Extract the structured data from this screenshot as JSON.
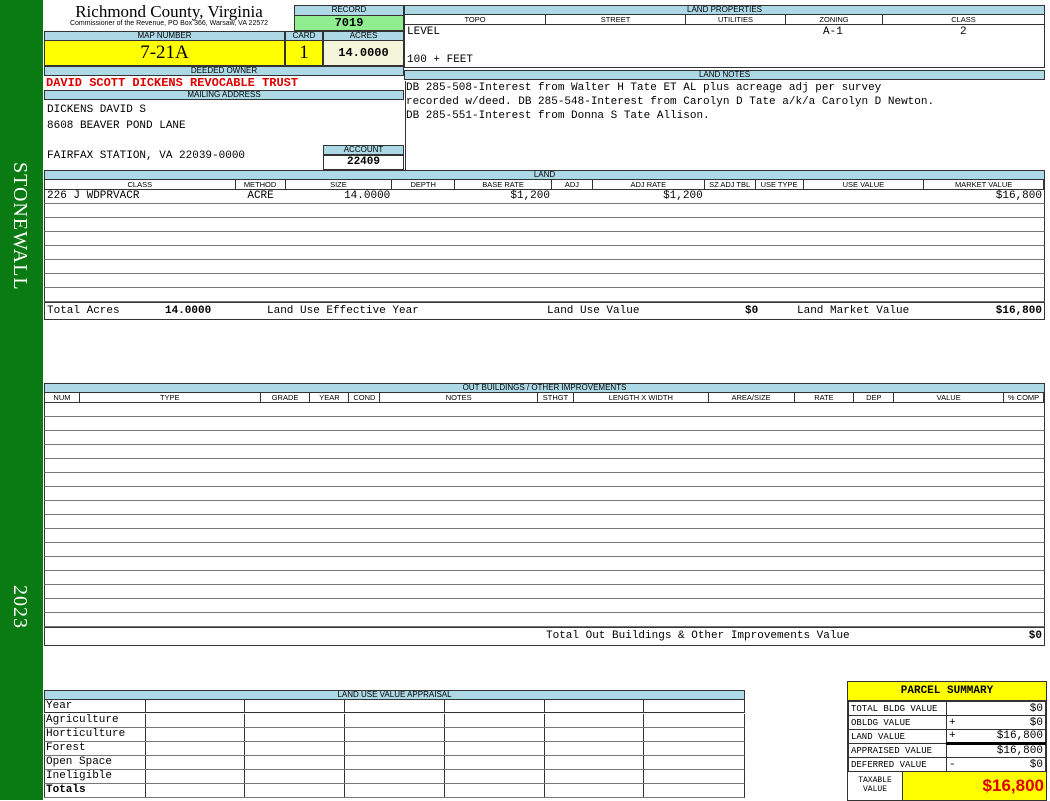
{
  "sidebar": {
    "district": "STONEWALL",
    "year": "2023"
  },
  "header": {
    "county": "Richmond County, Virginia",
    "office": "Commissioner of the Revenue, PO Box 366, Warsaw, VA 22572",
    "record_label": "RECORD",
    "record": "7019",
    "map_label": "MAP NUMBER",
    "map": "7-21A",
    "card_label": "CARD",
    "card": "1",
    "acres_label": "ACRES",
    "acres": "14.0000"
  },
  "owner": {
    "deeded_label": "DEEDED OWNER",
    "deeded": "DAVID SCOTT DICKENS REVOCABLE TRUST",
    "mailing_label": "MAILING ADDRESS",
    "line1": "DICKENS DAVID S",
    "line2": "8608 BEAVER POND LANE",
    "line3": "FAIRFAX STATION, VA 22039-0000",
    "account_label": "ACCOUNT",
    "account": "22409"
  },
  "land_properties": {
    "title": "LAND PROPERTIES",
    "columns": [
      "TOPO",
      "STREET",
      "UTILITIES",
      "ZONING",
      "CLASS"
    ],
    "topo": "LEVEL",
    "topo2": "100 + FEET",
    "zoning": "A-1",
    "class": "2"
  },
  "land_notes": {
    "title": "LAND NOTES",
    "lines": [
      "DB 285-508-Interest from Walter H Tate ET AL plus acreage adj per survey",
      "recorded w/deed. DB 285-548-Interest from Carolyn D Tate a/k/a Carolyn D Newton.",
      "DB 285-551-Interest from Donna S Tate Allison."
    ]
  },
  "land": {
    "title": "LAND",
    "columns": [
      "CLASS",
      "METHOD",
      "SIZE",
      "DEPTH",
      "BASE RATE",
      "ADJ",
      "ADJ RATE",
      "SZ ADJ TBL",
      "USE TYPE",
      "USE VALUE",
      "MARKET VALUE"
    ],
    "rows": [
      [
        "226 J WDPRVACR",
        "ACRE",
        "14.0000",
        "",
        "$1,200",
        "",
        "$1,200",
        "",
        "",
        "",
        "$16,800"
      ]
    ],
    "total_acres_label": "Total Acres",
    "total_acres": "14.0000",
    "effective_year_label": "Land Use Effective Year",
    "use_value_label": "Land Use Value",
    "use_value": "$0",
    "market_value_label": "Land Market Value",
    "market_value": "$16,800"
  },
  "outbuildings": {
    "title": "OUT BUILDINGS / OTHER IMPROVEMENTS",
    "columns": [
      "NUM",
      "TYPE",
      "GRADE",
      "YEAR",
      "COND",
      "NOTES",
      "STHGT",
      "LENGTH X WIDTH",
      "AREA/SIZE",
      "RATE",
      "DEP",
      "VALUE",
      "% COMP"
    ],
    "total_label": "Total Out Buildings & Other Improvements Value",
    "total": "$0"
  },
  "land_use": {
    "title": "LAND USE VALUE APPRAISAL",
    "rows": [
      "Year",
      "Agriculture",
      "Horticulture",
      "Forest",
      "Open Space",
      "Ineligible",
      "Totals"
    ]
  },
  "summary": {
    "title": "PARCEL SUMMARY",
    "rows": [
      {
        "label": "TOTAL BLDG VALUE",
        "op": "",
        "value": "$0"
      },
      {
        "label": "OBLDG VALUE",
        "op": "+",
        "value": "$0"
      },
      {
        "label": "LAND VALUE",
        "op": "+",
        "value": "$16,800"
      },
      {
        "label": "APPRAISED VALUE",
        "op": "",
        "value": "$16,800"
      },
      {
        "label": "DEFERRED VALUE",
        "op": "-",
        "value": "$0"
      }
    ],
    "taxable_label": "TAXABLE VALUE",
    "taxable": "$16,800"
  },
  "colors": {
    "sidebar": "#0a7a12",
    "header": "#add8e6",
    "highlight": "#ffff00",
    "record": "#90ee90",
    "owner": "#dd0000"
  }
}
